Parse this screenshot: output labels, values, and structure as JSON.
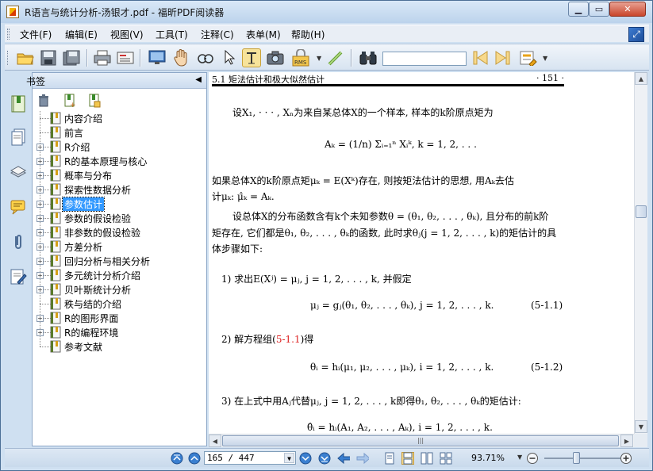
{
  "window": {
    "title": "R语言与统计分析-汤银才.pdf - 福昕PDF阅读器",
    "controls": [
      "minimize",
      "maximize",
      "close"
    ]
  },
  "menu": {
    "items": [
      "文件(F)",
      "编辑(E)",
      "视图(V)",
      "工具(T)",
      "注释(C)",
      "表单(M)",
      "帮助(H)"
    ]
  },
  "toolbar": {
    "search_value": "",
    "icons": [
      "open-icon",
      "save-icon",
      "save-as-icon",
      "print-icon",
      "properties-icon",
      "fullscreen-icon",
      "hand-icon",
      "zoom-glass-icon",
      "select-arrow-icon",
      "text-select-icon",
      "snapshot-icon",
      "rms-icon",
      "typewriter-icon",
      "binoculars-icon",
      "search-prev-icon",
      "search-next-icon",
      "highlight-icon"
    ]
  },
  "bookmarks": {
    "title": "书签",
    "items": [
      {
        "label": "内容介绍",
        "expandable": false
      },
      {
        "label": "前言",
        "expandable": false
      },
      {
        "label": "R介绍",
        "expandable": true
      },
      {
        "label": "R的基本原理与核心",
        "expandable": true
      },
      {
        "label": "概率与分布",
        "expandable": true
      },
      {
        "label": "探索性数据分析",
        "expandable": true
      },
      {
        "label": "参数估计",
        "expandable": true,
        "selected": true
      },
      {
        "label": "参数的假设检验",
        "expandable": true
      },
      {
        "label": "非参数的假设检验",
        "expandable": true
      },
      {
        "label": "方差分析",
        "expandable": true
      },
      {
        "label": "回归分析与相关分析",
        "expandable": true
      },
      {
        "label": "多元统计分析介绍",
        "expandable": true
      },
      {
        "label": "贝叶斯统计分析",
        "expandable": true
      },
      {
        "label": "秩与结的介绍",
        "expandable": false
      },
      {
        "label": "R的图形界面",
        "expandable": true
      },
      {
        "label": "R的编程环境",
        "expandable": true
      },
      {
        "label": "参考文献",
        "expandable": false
      }
    ]
  },
  "document": {
    "running_head": "5.1 矩法估计和极大似然估计",
    "page_number": "· 151 ·",
    "p1": "设X₁, · · · , Xₙ为来自某总体X的一个样本, 样本的k阶原点矩为",
    "eq1": "Aₖ = (1/n) Σᵢ₌₁ⁿ Xᵢᵏ, k = 1, 2, . . .",
    "p2a": "如果总体X的k阶原点矩μₖ = E(Xᵏ)存在, 则按矩法估计的思想, 用Aₖ去估",
    "p2b": "计μₖ: μ̂ₖ = Aₖ.",
    "p3a": "设总体X的分布函数含有k个未知参数θ = (θ₁, θ₂, . . . , θₖ), 且分布的前k阶",
    "p3b": "矩存在, 它们都是θ₁, θ₂, . . . , θₖ的函数, 此时求θⱼ(j = 1, 2, . . . , k)的矩估计的具",
    "p3c": "体步骤如下:",
    "step1": "1)  求出E(Xʲ) = μⱼ, j = 1, 2, . . . , k, 并假定",
    "eq2": "μⱼ = gⱼ(θ₁, θ₂, . . . , θₖ),  j = 1, 2, . . . , k.",
    "eq2_num": "(5-1.1)",
    "step2_pre": "2)  解方程组(",
    "step2_ref": "5-1.1",
    "step2_post": ")得",
    "eq3": "θᵢ = hᵢ(μ₁, μ₂, . . . , μₖ),  i = 1, 2, . . . , k.",
    "eq3_num": "(5-1.2)",
    "step3": "3)  在上式中用Aⱼ代替μⱼ, j = 1, 2, . . . , k即得θ₁, θ₂, . . . , θₖ的矩估计:",
    "eq4": "θ̂ᵢ = hᵢ(A₁, A₂, . . . , Aₖ),  i = 1, 2, . . . , k."
  },
  "statusbar": {
    "page_field": "165 / 447",
    "zoom": "93.71%"
  },
  "colors": {
    "chrome": "#cfe0f1",
    "selection": "#3399ff",
    "reference": "#dd2222"
  }
}
